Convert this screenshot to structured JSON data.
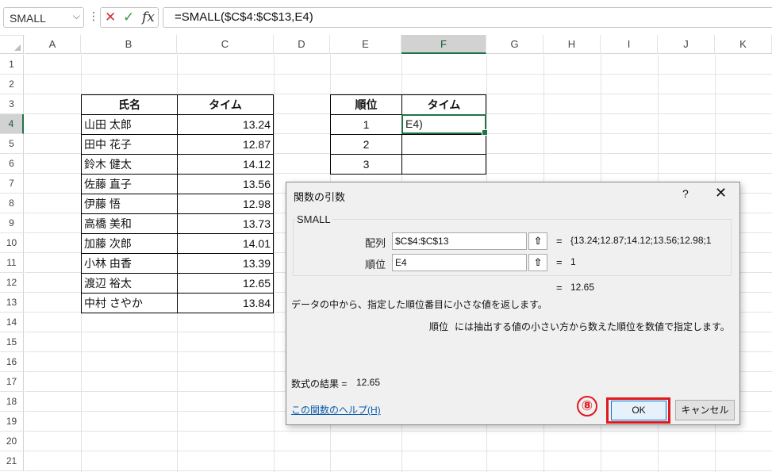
{
  "formula_bar": {
    "name_box": "SMALL",
    "formula": "=SMALL($C$4:$C$13,E4)"
  },
  "columns": [
    "A",
    "B",
    "C",
    "D",
    "E",
    "F",
    "G",
    "H",
    "I",
    "J",
    "K"
  ],
  "rows": [
    "1",
    "2",
    "3",
    "4",
    "5",
    "6",
    "7",
    "8",
    "9",
    "10",
    "11",
    "12",
    "13",
    "14",
    "15",
    "16",
    "17",
    "18",
    "19",
    "20",
    "21"
  ],
  "table1": {
    "headers": [
      "氏名",
      "タイム"
    ],
    "rows": [
      {
        "name": "山田 太郎",
        "time": "13.24"
      },
      {
        "name": "田中 花子",
        "time": "12.87"
      },
      {
        "name": "鈴木 健太",
        "time": "14.12"
      },
      {
        "name": "佐藤 直子",
        "time": "13.56"
      },
      {
        "name": "伊藤 悟",
        "time": "12.98"
      },
      {
        "name": "高橋 美和",
        "time": "13.73"
      },
      {
        "name": "加藤 次郎",
        "time": "14.01"
      },
      {
        "name": "小林 由香",
        "time": "13.39"
      },
      {
        "name": "渡辺 裕太",
        "time": "12.65"
      },
      {
        "name": "中村 さやか",
        "time": "13.84"
      }
    ]
  },
  "table2": {
    "headers": [
      "順位",
      "タイム"
    ],
    "ranks": [
      "1",
      "2",
      "3"
    ],
    "active_cell_text": "E4)"
  },
  "dialog": {
    "title": "関数の引数",
    "help_icon": "?",
    "close_icon": "✕",
    "function_name": "SMALL",
    "args": [
      {
        "label": "配列",
        "value": "$C$4:$C$13",
        "eq": "=",
        "result": "{13.24;12.87;14.12;13.56;12.98;1"
      },
      {
        "label": "順位",
        "value": "E4",
        "eq": "=",
        "result": "1"
      }
    ],
    "overall_eq": "=",
    "overall_result": "12.65",
    "description": "データの中から、指定した順位番目に小さな値を返します。",
    "arg_description_label": "順位",
    "arg_description": "には抽出する値の小さい方から数えた順位を数値で指定します。",
    "formula_result_label": "数式の結果 =",
    "formula_result_value": "12.65",
    "help_link": "この関数のヘルプ(H)",
    "ok_label": "OK",
    "cancel_label": "キャンセル",
    "step_badge": "⑧"
  }
}
